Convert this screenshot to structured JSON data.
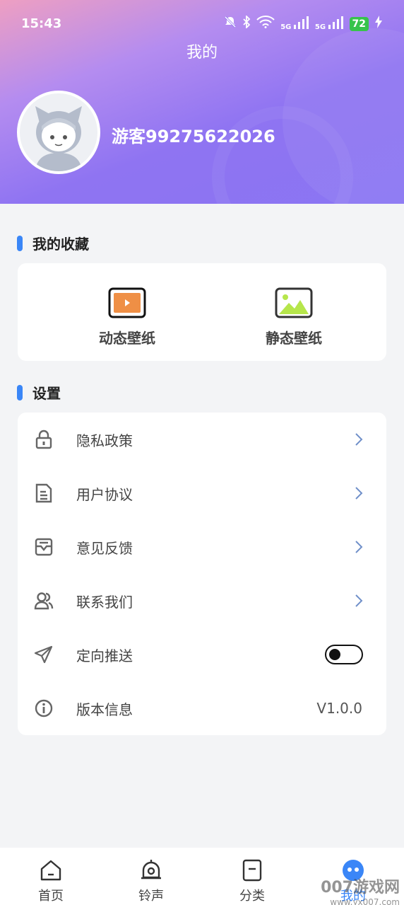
{
  "status_bar": {
    "time": "15:43",
    "battery": "72",
    "signal1": "5G",
    "signal2": "5G"
  },
  "header": {
    "title": "我的",
    "username": "游客99275622026"
  },
  "favorites": {
    "title": "我的收藏",
    "items": [
      {
        "label": "动态壁纸",
        "icon": "video-icon"
      },
      {
        "label": "静态壁纸",
        "icon": "image-icon"
      }
    ]
  },
  "settings": {
    "title": "设置",
    "items": [
      {
        "label": "隐私政策",
        "icon": "lock-icon"
      },
      {
        "label": "用户协议",
        "icon": "document-icon"
      },
      {
        "label": "意见反馈",
        "icon": "inbox-icon"
      },
      {
        "label": "联系我们",
        "icon": "users-icon"
      },
      {
        "label": "定向推送",
        "icon": "send-icon",
        "toggle_on": false
      },
      {
        "label": "版本信息",
        "icon": "info-icon",
        "value": "V1.0.0"
      }
    ]
  },
  "bottom_nav": [
    {
      "label": "首页",
      "icon": "home-icon"
    },
    {
      "label": "铃声",
      "icon": "bell-icon"
    },
    {
      "label": "分类",
      "icon": "category-icon"
    },
    {
      "label": "我的",
      "icon": "profile-icon",
      "active": true
    }
  ],
  "watermark": {
    "main": "007游戏网",
    "sub": "www.yx007.com"
  },
  "colors": {
    "accent": "#3a86f7",
    "header_start": "#ee9fc2",
    "header_end": "#8a75f3"
  }
}
